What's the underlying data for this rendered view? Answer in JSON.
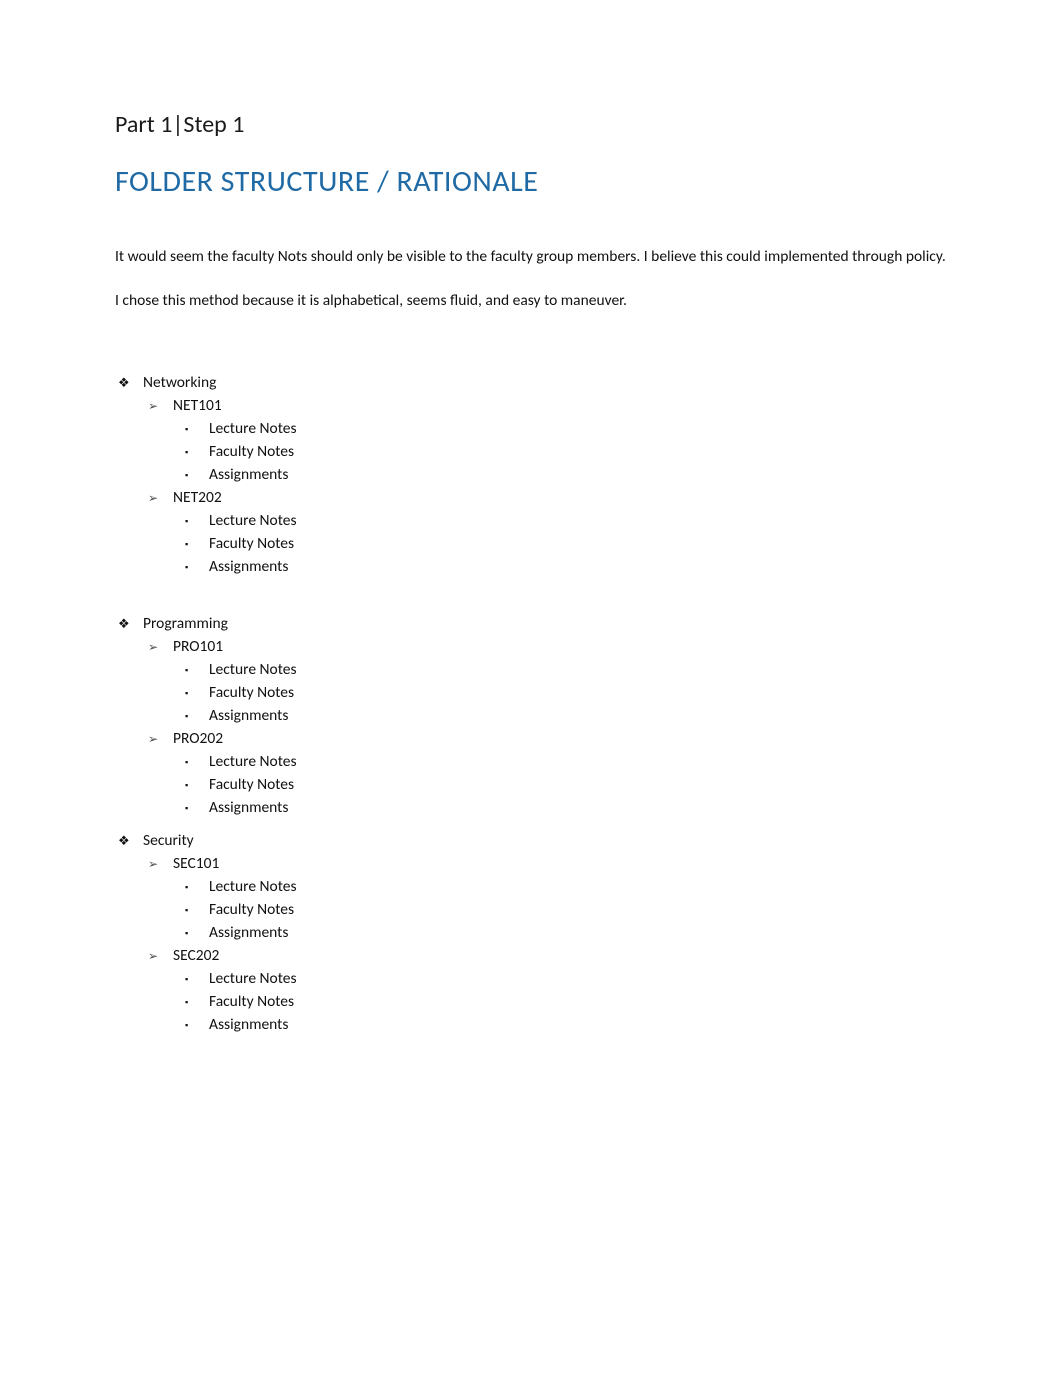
{
  "subtitle": "Part 1|Step 1",
  "title": "FOLDER STRUCTURE / RATIONALE",
  "paragraphs": [
    "It would seem the faculty Nots should only be visible to the faculty group members.  I believe this could implemented through policy.",
    "I chose this method because it is alphabetical, seems fluid, and easy to maneuver."
  ],
  "bullets": {
    "lvl1": "❖",
    "lvl2": "➢",
    "lvl3": "▪"
  },
  "sections": [
    {
      "name": "Networking",
      "courses": [
        {
          "code": "NET101",
          "items": [
            "Lecture Notes",
            "Faculty Notes",
            "Assignments"
          ]
        },
        {
          "code": "NET202",
          "items": [
            "Lecture Notes",
            "Faculty Notes",
            "Assignments"
          ]
        }
      ]
    },
    {
      "name": "Programming",
      "courses": [
        {
          "code": "PRO101",
          "items": [
            "Lecture Notes",
            "Faculty Notes",
            "Assignments"
          ]
        },
        {
          "code": "PRO202",
          "items": [
            "Lecture Notes",
            "Faculty Notes",
            "Assignments"
          ]
        }
      ]
    },
    {
      "name": "Security",
      "courses": [
        {
          "code": "SEC101",
          "items": [
            "Lecture Notes",
            "Faculty Notes",
            "Assignments"
          ]
        },
        {
          "code": "SEC202",
          "items": [
            "Lecture Notes",
            "Faculty Notes",
            "Assignments"
          ]
        }
      ]
    }
  ]
}
